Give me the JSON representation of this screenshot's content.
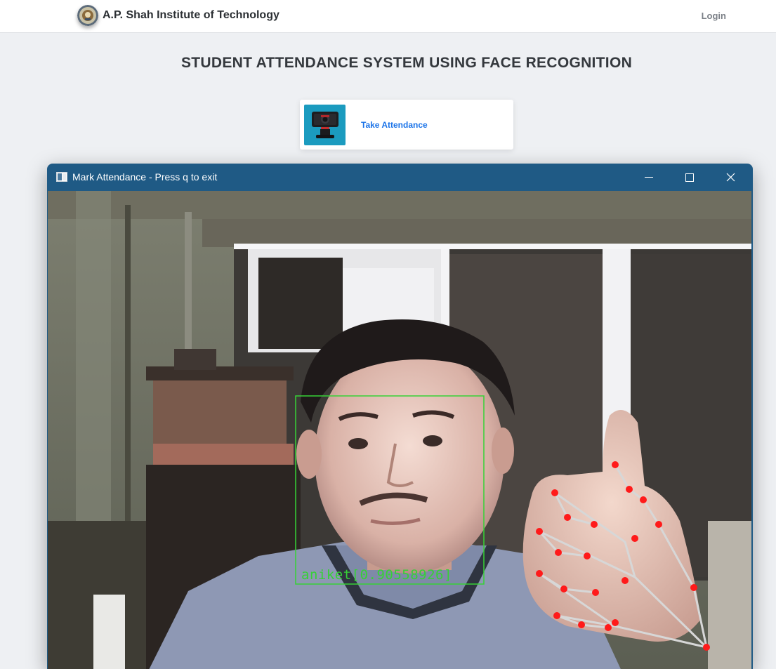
{
  "navbar": {
    "brand_name": "A.P. Shah Institute of Technology",
    "login_label": "Login"
  },
  "page": {
    "title": "STUDENT ATTENDANCE SYSTEM USING FACE RECOGNITION"
  },
  "card": {
    "label": "Take Attendance",
    "icon": "webcam-icon"
  },
  "window": {
    "title": "Mark Attendance - Press q to exit",
    "controls": [
      "minimize",
      "maximize",
      "close"
    ]
  },
  "detection": {
    "label": "aniket[0.90558926]",
    "box_color": "#36d136",
    "landmark_color": "#ff1a1a"
  },
  "colors": {
    "titlebar": "#1f5a85",
    "link": "#1a73e8"
  }
}
